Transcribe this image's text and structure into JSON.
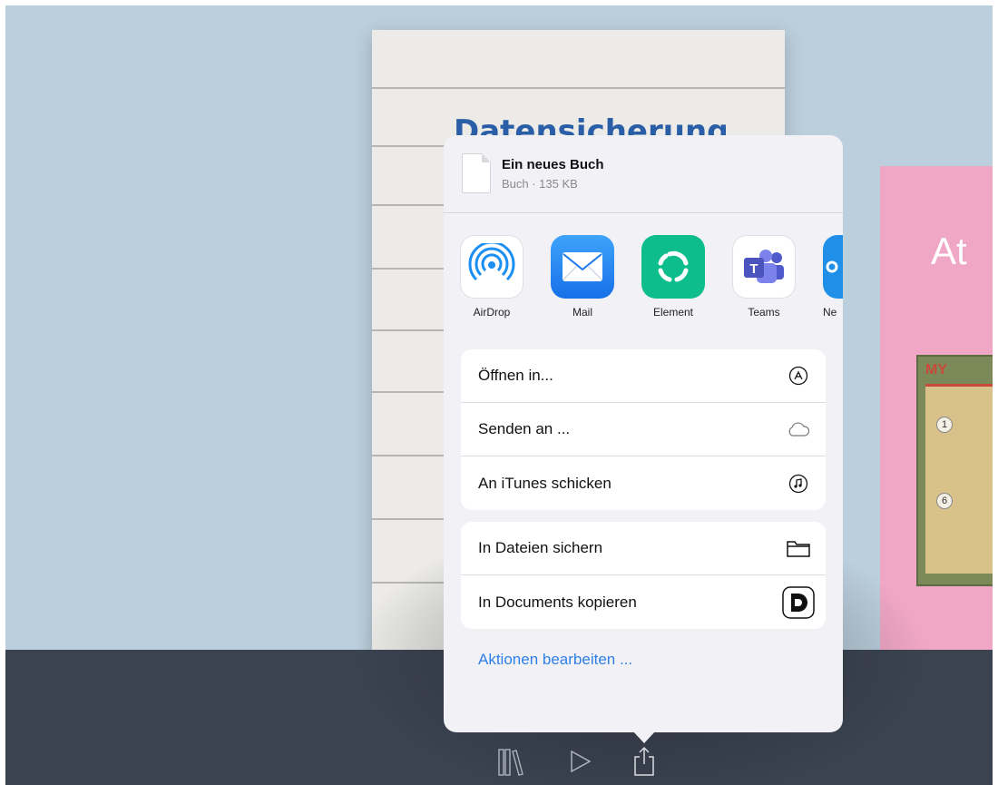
{
  "book_left": {
    "title": "Datensicherung"
  },
  "book_right": {
    "title": "At",
    "board_badge": "MY",
    "board_dots": [
      "1",
      "6"
    ]
  },
  "share_sheet": {
    "file_name": "Ein neues Buch",
    "file_meta": "Buch · 135 KB",
    "apps": [
      {
        "label": "AirDrop",
        "icon": "airdrop-icon"
      },
      {
        "label": "Mail",
        "icon": "mail-icon"
      },
      {
        "label": "Element",
        "icon": "element-icon"
      },
      {
        "label": "Teams",
        "icon": "teams-icon"
      },
      {
        "label": "Ne",
        "icon": "partial-app-icon"
      }
    ],
    "group1": [
      {
        "label": "Öffnen in...",
        "icon": "app-store-icon"
      },
      {
        "label": "Senden an ...",
        "icon": "cloud-icon"
      },
      {
        "label": "An iTunes schicken",
        "icon": "music-note-icon"
      }
    ],
    "group2": [
      {
        "label": "In Dateien sichern",
        "icon": "folder-icon"
      },
      {
        "label": "In Documents kopieren",
        "icon": "documents-app-icon"
      }
    ],
    "edit_actions": "Aktionen bearbeiten ..."
  },
  "toolbar": {
    "icons": [
      "library-icon",
      "play-icon",
      "share-icon"
    ]
  },
  "colors": {
    "background": "#bccfdd",
    "bottom_bar": "#3b4250",
    "accent_link": "#2f7fe8",
    "book_title": "#2a5fa8",
    "pink_book": "#f0a7c5"
  }
}
